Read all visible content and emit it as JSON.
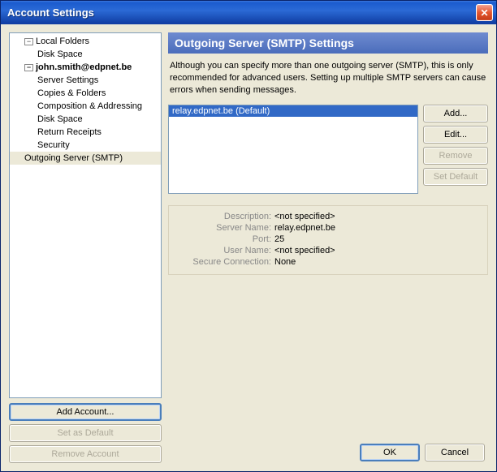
{
  "window": {
    "title": "Account Settings"
  },
  "tree": {
    "localFolders": "Local Folders",
    "diskSpace": "Disk Space",
    "account": "john.smith@edpnet.be",
    "serverSettings": "Server Settings",
    "copiesFolders": "Copies & Folders",
    "compAddr": "Composition & Addressing",
    "diskSpace2": "Disk Space",
    "returnReceipts": "Return Receipts",
    "security": "Security",
    "smtp": "Outgoing Server (SMTP)"
  },
  "leftButtons": {
    "addAccount": "Add Account...",
    "setDefault": "Set as Default",
    "removeAccount": "Remove Account"
  },
  "panel": {
    "heading": "Outgoing Server (SMTP) Settings",
    "description": "Although you can specify more than one outgoing server (SMTP), this is only recommended for advanced users. Setting up multiple SMTP servers can cause errors when sending messages."
  },
  "servers": {
    "item": "relay.edpnet.be (Default)"
  },
  "rtButtons": {
    "add": "Add...",
    "edit": "Edit...",
    "remove": "Remove",
    "setDefault": "Set Default"
  },
  "details": {
    "k_desc": "Description:",
    "k_server": "Server Name:",
    "k_port": "Port:",
    "k_user": "User Name:",
    "k_sec": "Secure Connection:",
    "v_desc": "<not specified>",
    "v_server": "relay.edpnet.be",
    "v_port": "25",
    "v_user": "<not specified>",
    "v_sec": "None"
  },
  "bottomButtons": {
    "ok": "OK",
    "cancel": "Cancel"
  }
}
